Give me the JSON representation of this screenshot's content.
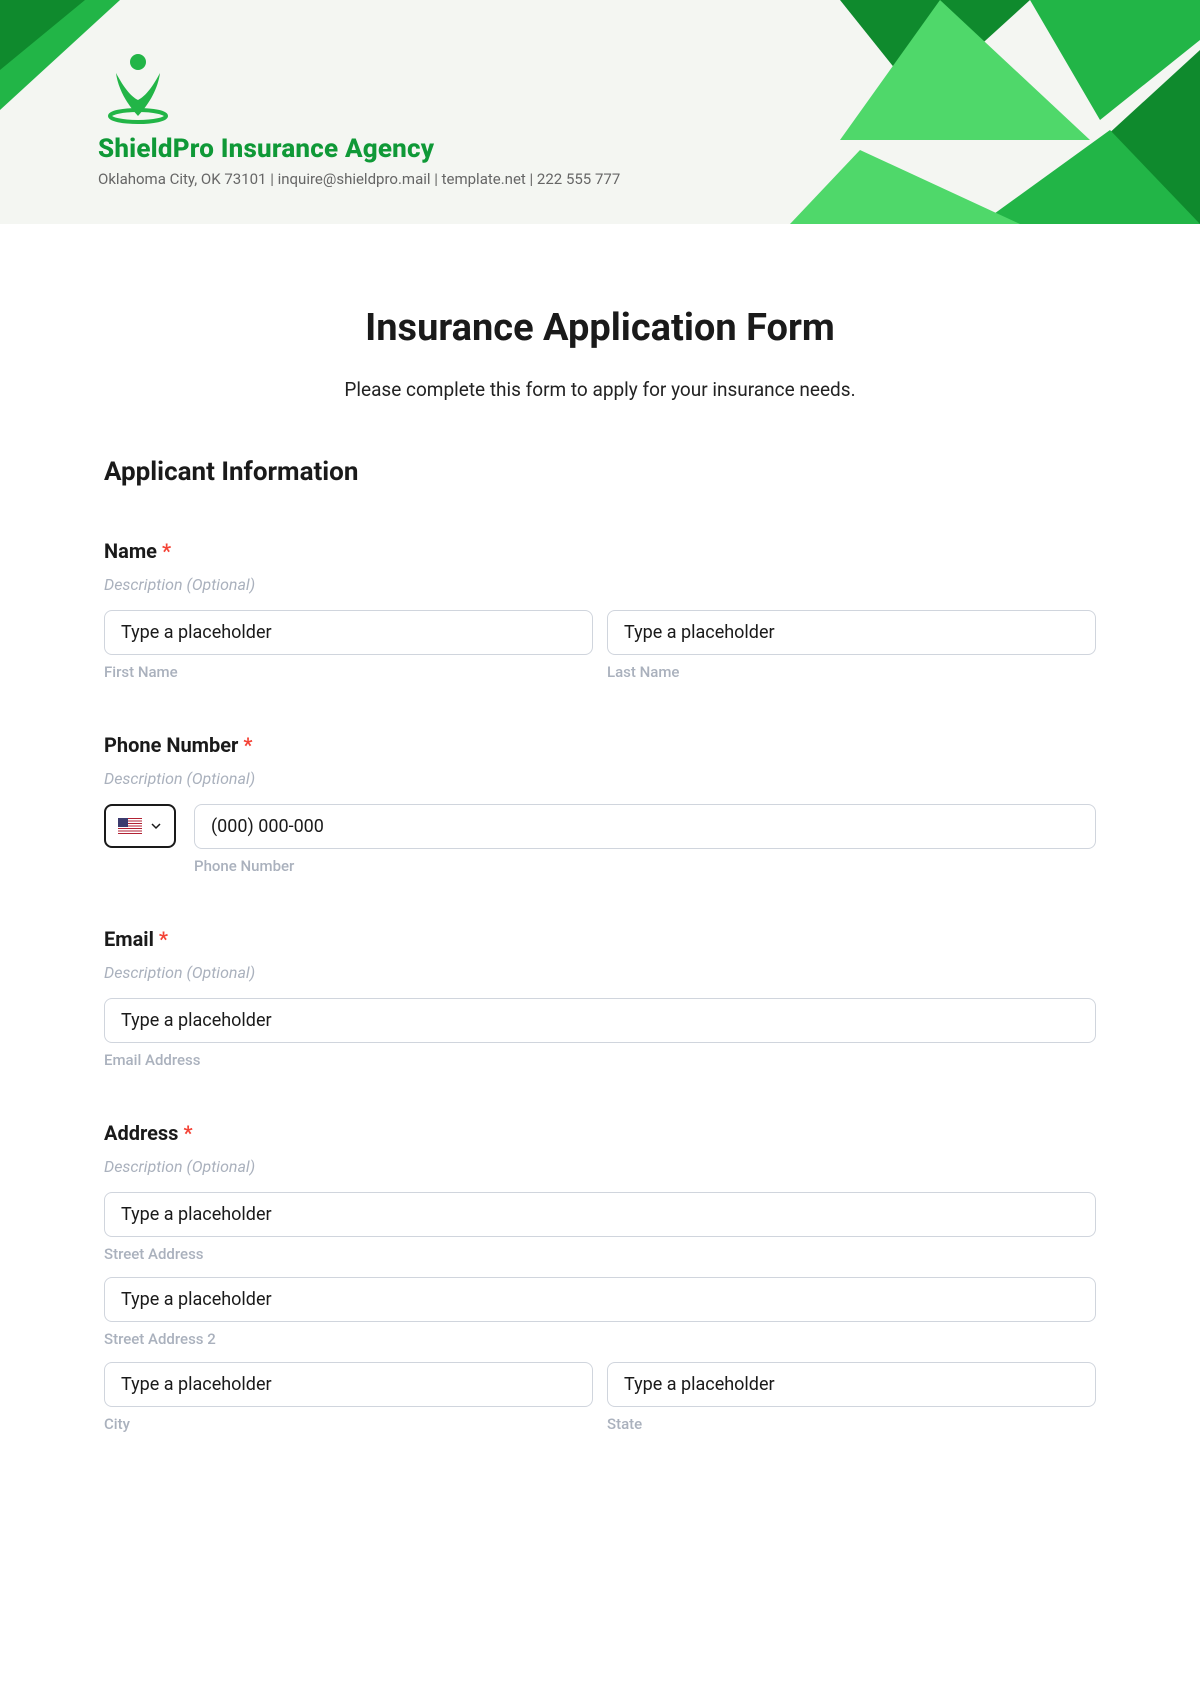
{
  "header": {
    "company_name": "ShieldPro Insurance Agency",
    "company_info": "Oklahoma City, OK 73101 | inquire@shieldpro.mail | template.net | 222 555 777"
  },
  "page": {
    "title": "Insurance Application Form",
    "subtitle": "Please complete this form to apply for your insurance needs."
  },
  "section": {
    "applicant_info": "Applicant Information"
  },
  "labels": {
    "name": "Name",
    "phone": "Phone Number",
    "email": "Email",
    "address": "Address",
    "required": "*",
    "desc_optional": "Description (Optional)"
  },
  "placeholders": {
    "type": "Type a placeholder",
    "phone": "(000) 000-000"
  },
  "sublabels": {
    "first_name": "First Name",
    "last_name": "Last Name",
    "phone_number": "Phone Number",
    "email_address": "Email Address",
    "street_address": "Street Address",
    "street_address_2": "Street Address 2",
    "city": "City",
    "state": "State"
  }
}
